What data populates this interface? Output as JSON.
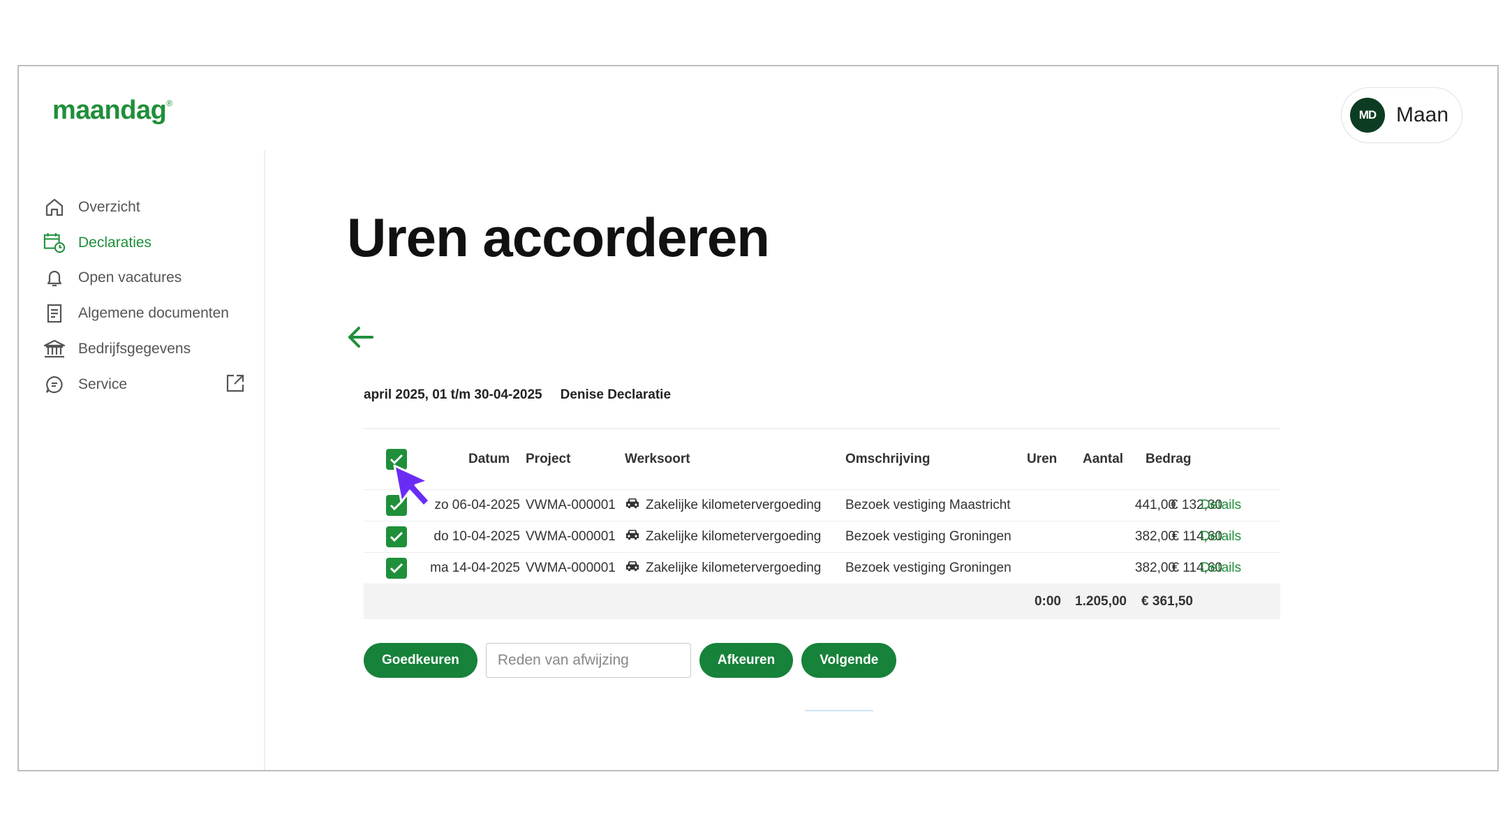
{
  "brand": {
    "logo_text": "maandag",
    "logo_mark": "®"
  },
  "user": {
    "initials": "MD",
    "name": "Maan"
  },
  "sidebar": {
    "items": [
      {
        "label": "Overzicht",
        "icon": "home-icon"
      },
      {
        "label": "Declaraties",
        "icon": "calendar-clock-icon",
        "active": true
      },
      {
        "label": "Open vacatures",
        "icon": "bell-icon"
      },
      {
        "label": "Algemene documenten",
        "icon": "document-icon"
      },
      {
        "label": "Bedrijfsgegevens",
        "icon": "bank-icon"
      },
      {
        "label": "Service",
        "icon": "chat-icon",
        "external_icon": "external-link-icon"
      }
    ]
  },
  "page": {
    "title": "Uren accorderen",
    "period": "april 2025, 01 t/m 30-04-2025",
    "declaration_name": "Denise Declaratie"
  },
  "table": {
    "columns": [
      "Datum",
      "Project",
      "Werksoort",
      "Omschrijving",
      "Uren",
      "Aantal",
      "Bedrag"
    ],
    "rows": [
      {
        "checked": true,
        "datum": "zo 06-04-2025",
        "project": "VWMA-000001",
        "werksoort": "Zakelijke kilometervergoeding",
        "omschrijving": "Bezoek vestiging Maastricht",
        "uren": "",
        "aantal": "441,00",
        "bedrag": "€ 132,30",
        "link": "Details"
      },
      {
        "checked": true,
        "datum": "do 10-04-2025",
        "project": "VWMA-000001",
        "werksoort": "Zakelijke kilometervergoeding",
        "omschrijving": "Bezoek vestiging Groningen",
        "uren": "",
        "aantal": "382,00",
        "bedrag": "€ 114,60",
        "link": "Details"
      },
      {
        "checked": true,
        "datum": "ma 14-04-2025",
        "project": "VWMA-000001",
        "werksoort": "Zakelijke kilometervergoeding",
        "omschrijving": "Bezoek vestiging Groningen",
        "uren": "",
        "aantal": "382,00",
        "bedrag": "€ 114,60",
        "link": "Details"
      }
    ],
    "totals": {
      "uren": "0:00",
      "aantal": "1.205,00",
      "bedrag": "€ 361,50"
    }
  },
  "actions": {
    "approve_label": "Goedkeuren",
    "reject_reason_placeholder": "Reden van afwijzing",
    "reject_label": "Afkeuren",
    "next_label": "Volgende"
  },
  "colors": {
    "brand_green": "#1f8f3a",
    "button_green": "#17823a",
    "avatar_bg": "#0c3d22",
    "cursor": "#6a2cf5"
  }
}
